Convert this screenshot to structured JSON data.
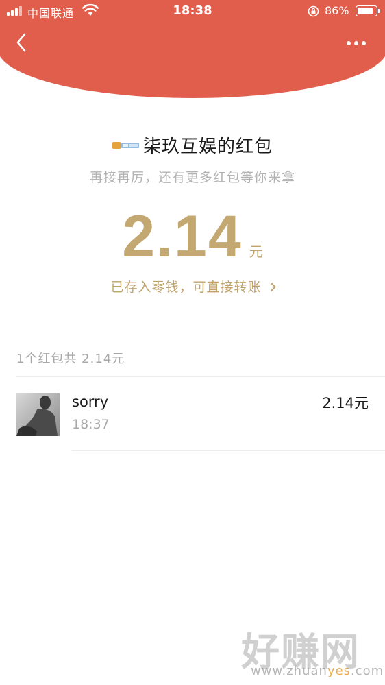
{
  "status_bar": {
    "carrier": "中国联通",
    "time": "18:38",
    "battery_percent": "86%",
    "battery_level": 0.86,
    "icons": [
      "signal-icon",
      "wifi-icon",
      "rotation-lock-icon",
      "battery-icon"
    ]
  },
  "nav": {
    "back_icon": "chevron-left-icon",
    "more_icon": "more-dots-icon"
  },
  "colors": {
    "header_red": "#E25E4C",
    "gold": "#BFA36B"
  },
  "envelope": {
    "sender_name": "柒玖互娱的红包",
    "blessing": "再接再厉，还有更多红包等你来拿",
    "amount": "2.14",
    "unit": "元",
    "deposit_text": "已存入零钱，可直接转账"
  },
  "summary": "1个红包共 2.14元",
  "records": [
    {
      "name": "sorry",
      "time": "18:37",
      "amount": "2.14元"
    }
  ],
  "watermark": {
    "big": "好赚网",
    "small_prefix": "www.zhuan",
    "small_highlight": "yes",
    "small_suffix": ".com"
  }
}
